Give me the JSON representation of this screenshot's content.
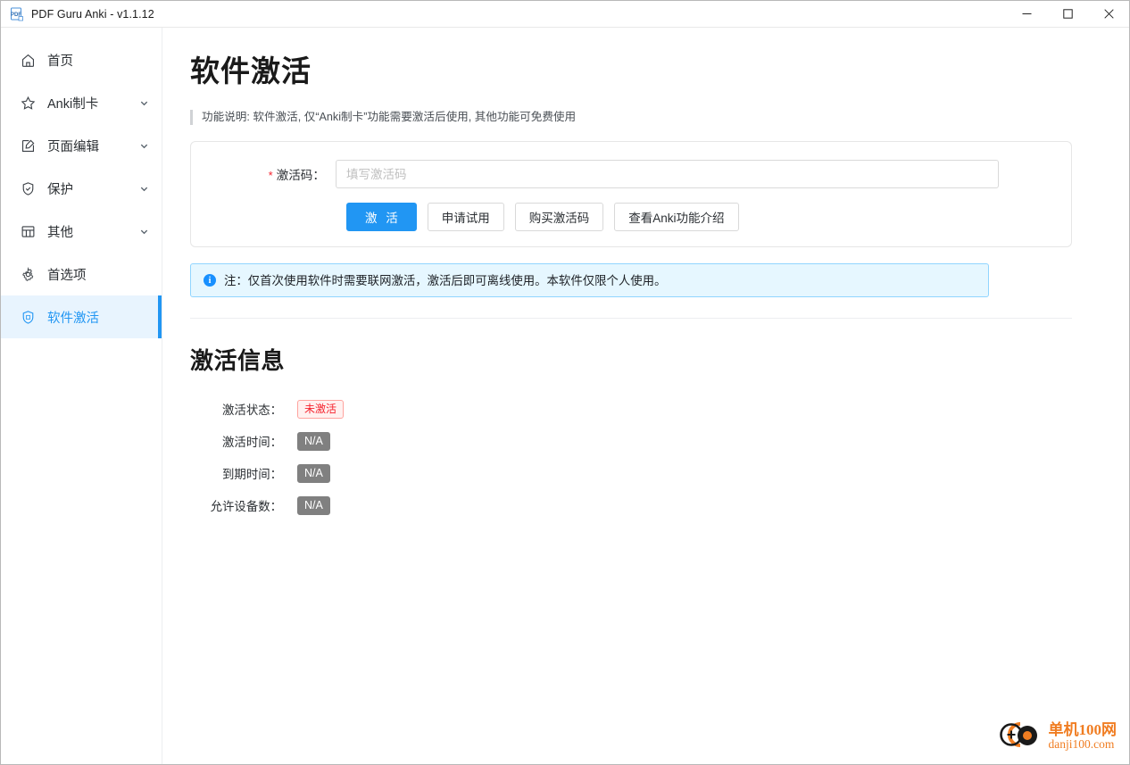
{
  "window": {
    "title": "PDF Guru Anki - v1.1.12",
    "app_icon": "pdf-icon",
    "controls": {
      "minimize": "—",
      "maximize": "☐",
      "close": "✕"
    }
  },
  "sidebar": {
    "items": [
      {
        "label": "首页",
        "icon": "home-icon",
        "has_chevron": false,
        "active": false
      },
      {
        "label": "Anki制卡",
        "icon": "star-icon",
        "has_chevron": true,
        "active": false
      },
      {
        "label": "页面编辑",
        "icon": "edit-icon",
        "has_chevron": true,
        "active": false
      },
      {
        "label": "保护",
        "icon": "shield-check-icon",
        "has_chevron": true,
        "active": false
      },
      {
        "label": "其他",
        "icon": "grid-icon",
        "has_chevron": true,
        "active": false
      },
      {
        "label": "首选项",
        "icon": "gear-icon",
        "has_chevron": false,
        "active": false
      },
      {
        "label": "软件激活",
        "icon": "shield-icon",
        "has_chevron": false,
        "active": true
      }
    ],
    "chevron_glyph": "⌄",
    "active_color": "#2196f3",
    "active_bg": "#e8f4fe"
  },
  "main": {
    "page_title": "软件激活",
    "description": "功能说明: 软件激活, 仅“Anki制卡”功能需要激活后使用, 其他功能可免费使用",
    "form": {
      "required_mark": "*",
      "label": "激活码：",
      "input_value": "",
      "input_placeholder": "填写激活码",
      "buttons": [
        {
          "label": "激 活",
          "type": "primary"
        },
        {
          "label": "申请试用",
          "type": "default"
        },
        {
          "label": "购买激活码",
          "type": "default"
        },
        {
          "label": "查看Anki功能介绍",
          "type": "default"
        }
      ],
      "primary_color": "#2196f3"
    },
    "alert": {
      "icon": "info-circle-icon",
      "icon_glyph": "i",
      "text": "注：仅首次使用软件时需要联网激活，激活后即可离线使用。本软件仅限个人使用。",
      "bg": "#e6f7ff",
      "border": "#91d5ff"
    },
    "activation_info": {
      "section_title": "激活信息",
      "rows": [
        {
          "label": "激活状态：",
          "value": "未激活",
          "style": "danger"
        },
        {
          "label": "激活时间：",
          "value": "N/A",
          "style": "gray"
        },
        {
          "label": "到期时间：",
          "value": "N/A",
          "style": "gray"
        },
        {
          "label": "允许设备数：",
          "value": "N/A",
          "style": "gray"
        }
      ],
      "danger_color": "#f5222d",
      "gray_color": "#808080"
    }
  },
  "watermark": {
    "name_cn": "单机100网",
    "domain": "danji100.com",
    "color": "#f07d22"
  }
}
